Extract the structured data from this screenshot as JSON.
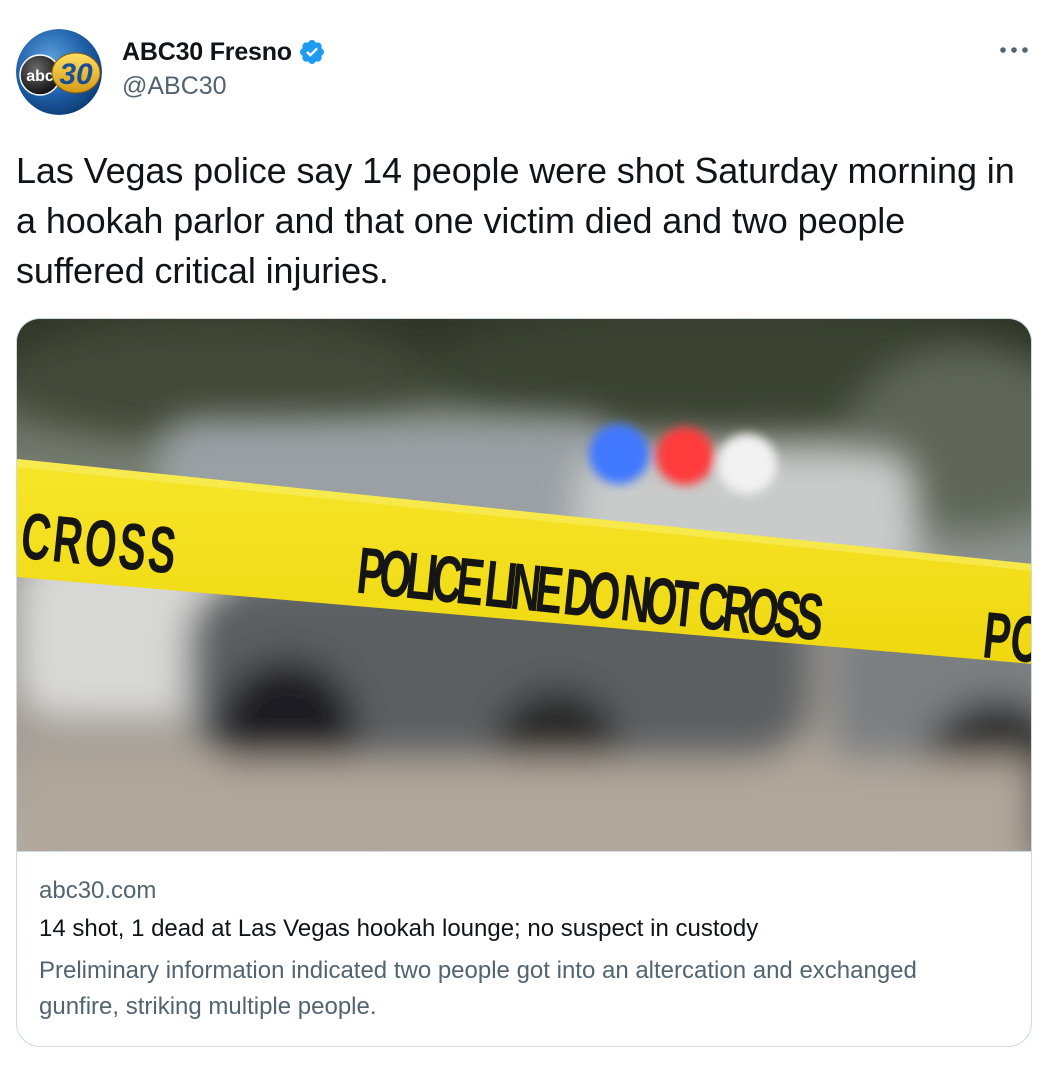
{
  "author": {
    "display_name": "ABC30 Fresno",
    "handle": "@ABC30",
    "verified": true,
    "avatar_logo_text": "abc",
    "avatar_logo_number": "30"
  },
  "tweet": {
    "text": "Las Vegas police say 14 people were shot Saturday morning in a hookah parlor and that one victim died and two people suffered critical injuries."
  },
  "card": {
    "image_tape_text_main": "POLICE LINE DO NOT CROSS",
    "image_tape_text_left": "CROSS",
    "image_tape_text_right": "PO",
    "domain": "abc30.com",
    "title": "14 shot, 1 dead at Las Vegas hookah lounge; no suspect in custody",
    "description": "Preliminary information indicated two people got into an altercation and exchanged gunfire, striking multiple people."
  },
  "icons": {
    "more": "more-horizontal-icon",
    "verified": "verified-badge-icon"
  },
  "colors": {
    "text_primary": "#0f1419",
    "text_secondary": "#536471",
    "verified_blue": "#1d9bf0",
    "border": "#cfd9de",
    "tape_yellow": "#f4e11a"
  }
}
